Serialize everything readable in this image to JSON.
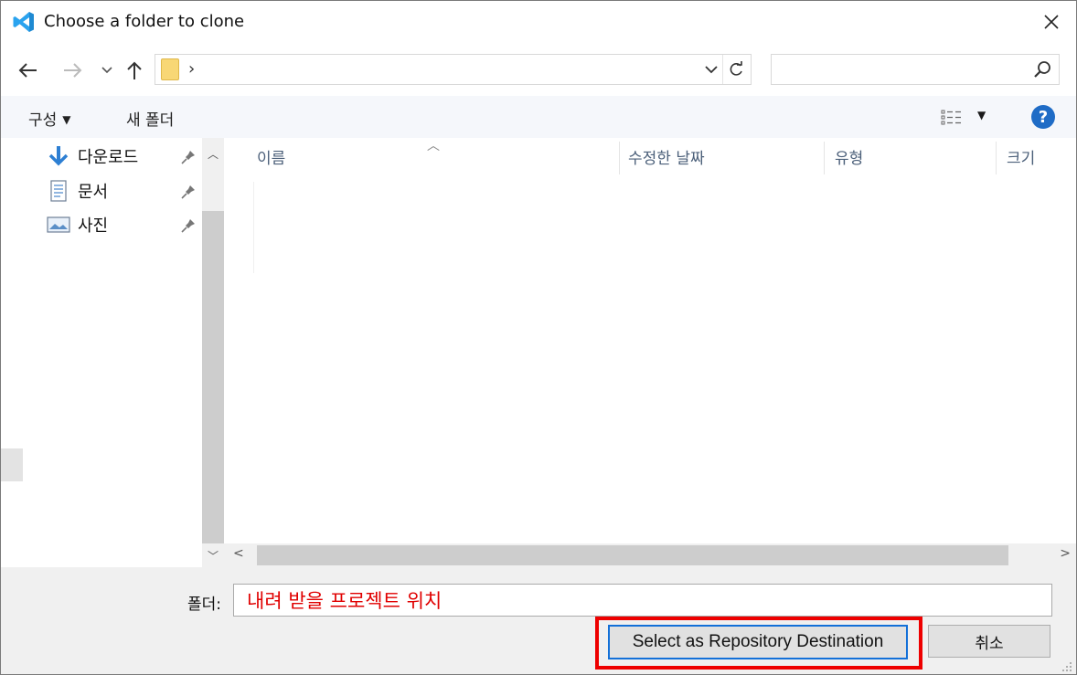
{
  "window": {
    "title": "Choose a folder to clone"
  },
  "address_bar": {
    "separator": "›"
  },
  "toolbar": {
    "organize_label": "구성",
    "new_folder_label": "새 폴더"
  },
  "quick_access": [
    {
      "label": "다운로드",
      "icon": "download-arrow-icon"
    },
    {
      "label": "문서",
      "icon": "document-icon"
    },
    {
      "label": "사진",
      "icon": "pictures-icon"
    }
  ],
  "file_list": {
    "columns": [
      "이름",
      "수정한 날짜",
      "유형",
      "크기"
    ],
    "rows": []
  },
  "bottom": {
    "folder_label": "폴더:",
    "folder_value": "내려 받을 프로젝트 위치",
    "select_button": "Select as Repository Destination",
    "cancel_button": "취소"
  },
  "colors": {
    "accent": "#1370d8",
    "highlight": "#ee0000",
    "folder_text": "#e00000"
  }
}
